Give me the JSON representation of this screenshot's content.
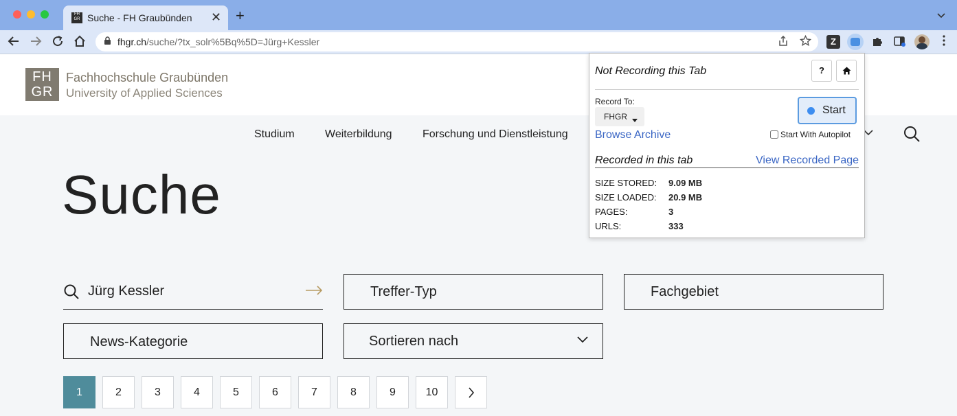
{
  "browser": {
    "tab_title": "Suche - FH Graubünden",
    "tab_favicon": "FH GR",
    "url_host": "fhgr.ch",
    "url_path": "/suche/?tx_solr%5Bq%5D=Jürg+Kessler",
    "controls": {
      "back": "←",
      "forward": "→",
      "reload": "↻",
      "home": "⌂",
      "new_tab": "+",
      "close": "✕",
      "tab_menu": "⌄"
    }
  },
  "site": {
    "logo_mark_top": "FH",
    "logo_mark_bottom": "GR",
    "logo_name": "Fachhochschule Graubünden",
    "logo_subtitle": "University of Applied Sciences",
    "nav": [
      "Studium",
      "Weiterbildung",
      "Forschung und Dienstleistung"
    ]
  },
  "page": {
    "title": "Suche",
    "search_value": "Jürg Kessler",
    "filters": {
      "treffer_typ": "Treffer-Typ",
      "fachgebiet": "Fachgebiet",
      "news_kategorie": "News-Kategorie",
      "sortieren": "Sortieren nach"
    },
    "pagination": [
      "1",
      "2",
      "3",
      "4",
      "5",
      "6",
      "7",
      "8",
      "9",
      "10"
    ],
    "current_page": "1"
  },
  "popup": {
    "status": "Not Recording this Tab",
    "help": "?",
    "record_to_label": "Record To:",
    "collection": "FHGR",
    "start_label": "Start",
    "browse_archive": "Browse Archive",
    "autopilot_label": "Start With Autopilot",
    "recorded_heading": "Recorded in this tab",
    "view_recorded": "View Recorded Page",
    "stats": [
      {
        "key": "SIZE STORED:",
        "value": "9.09 MB"
      },
      {
        "key": "SIZE LOADED:",
        "value": "20.9 MB"
      },
      {
        "key": "PAGES:",
        "value": "3"
      },
      {
        "key": "URLS:",
        "value": "333"
      }
    ]
  },
  "colors": {
    "tabbar": "#8aaee8",
    "toolbar": "#dde7f8",
    "accent_page": "#4f8c9b",
    "arrow_gold": "#b79b62",
    "link_blue": "#3a66c4"
  }
}
